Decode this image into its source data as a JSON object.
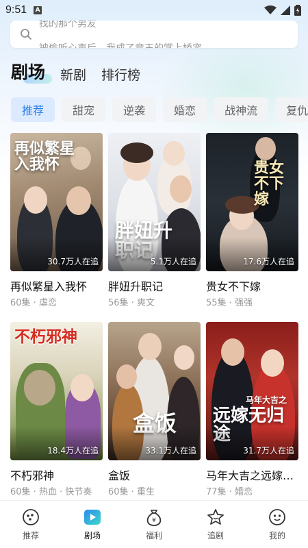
{
  "status_bar": {
    "time": "9:51",
    "notification_letter": "A"
  },
  "search": {
    "placeholder_lines": [
      "找的那个男友",
      "被偷听心声后，我成了竞王的掌上娇宠"
    ]
  },
  "top_tabs": [
    {
      "label": "剧场",
      "active": true
    },
    {
      "label": "新剧",
      "active": false
    },
    {
      "label": "排行榜",
      "active": false
    }
  ],
  "chips": [
    {
      "label": "推荐",
      "active": true
    },
    {
      "label": "甜宠",
      "active": false
    },
    {
      "label": "逆袭",
      "active": false
    },
    {
      "label": "婚恋",
      "active": false
    },
    {
      "label": "战神流",
      "active": false
    },
    {
      "label": "复仇",
      "active": false
    }
  ],
  "dramas": [
    {
      "title": "再似繁星入我怀",
      "poster_title": "再似繁星入我怀",
      "followers": "30.7万人在追",
      "meta": "60集 · 虐恋"
    },
    {
      "title": "胖妞升职记",
      "poster_title": "胖妞升职记",
      "followers": "5.1万人在追",
      "meta": "56集 · 爽文"
    },
    {
      "title": "贵女不下嫁",
      "poster_title": "贵女不下嫁",
      "followers": "17.6万人在追",
      "meta": "55集 · 强强"
    },
    {
      "title": "不朽邪神",
      "poster_title": "不朽邪神",
      "followers": "18.4万人在追",
      "meta": "60集 · 热血 · 快节奏"
    },
    {
      "title": "盒饭",
      "poster_title": "盒饭",
      "followers": "33.1万人在追",
      "meta": "60集 · 重生"
    },
    {
      "title": "马年大吉之远嫁无归途",
      "poster_title": "远嫁无归途",
      "poster_subtitle": "马年大吉之",
      "followers": "31.7万人在追",
      "meta": "77集 · 婚恋"
    }
  ],
  "bottom_nav": [
    {
      "label": "推荐",
      "icon": "recommend-icon",
      "active": false
    },
    {
      "label": "剧场",
      "icon": "theater-play-icon",
      "active": true
    },
    {
      "label": "福利",
      "icon": "welfare-money-bag-icon",
      "active": false
    },
    {
      "label": "追剧",
      "icon": "follow-star-icon",
      "active": false
    },
    {
      "label": "我的",
      "icon": "profile-face-icon",
      "active": false
    }
  ],
  "colors": {
    "accent": "#2b7de9",
    "chip_active_bg": "#dbeafe",
    "chip_bg": "#f1f3f5"
  }
}
